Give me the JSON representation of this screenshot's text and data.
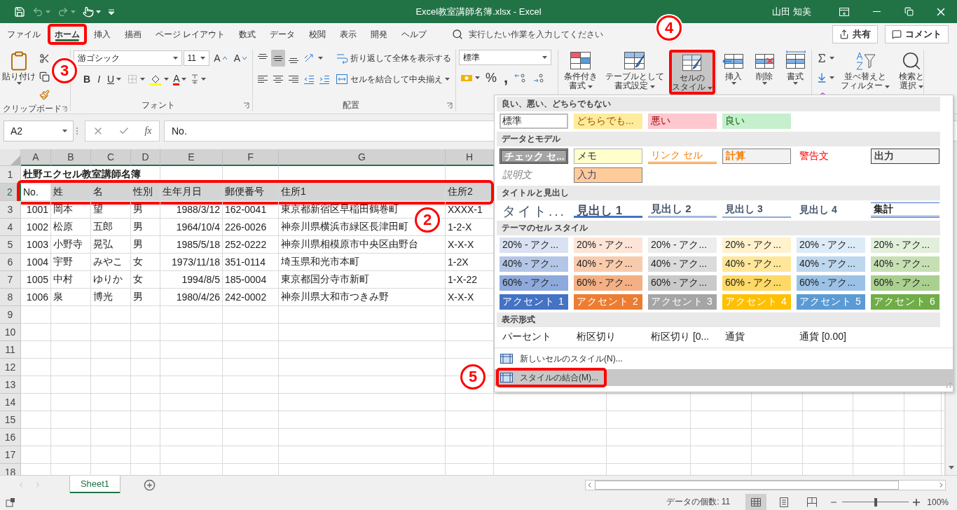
{
  "title_bar": {
    "title": "Excel教室講師名簿.xlsx  -  Excel",
    "user": "山田 知美",
    "quick_access": [
      {
        "kind": "save",
        "disabled": false
      },
      {
        "kind": "undo",
        "disabled": true
      },
      {
        "kind": "redo",
        "disabled": true
      },
      {
        "kind": "touch",
        "disabled": false
      }
    ]
  },
  "menu_tabs": [
    {
      "label": "ファイル",
      "selected": false,
      "highlighted": false
    },
    {
      "label": "ホーム",
      "selected": true,
      "highlighted": true
    },
    {
      "label": "挿入",
      "selected": false,
      "highlighted": false
    },
    {
      "label": "描画",
      "selected": false,
      "highlighted": false
    },
    {
      "label": "ページ レイアウト",
      "selected": false,
      "highlighted": false
    },
    {
      "label": "数式",
      "selected": false,
      "highlighted": false
    },
    {
      "label": "データ",
      "selected": false,
      "highlighted": false
    },
    {
      "label": "校閲",
      "selected": false,
      "highlighted": false
    },
    {
      "label": "表示",
      "selected": false,
      "highlighted": false
    },
    {
      "label": "開発",
      "selected": false,
      "highlighted": false
    },
    {
      "label": "ヘルプ",
      "selected": false,
      "highlighted": false
    }
  ],
  "search": {
    "placeholder": "実行したい作業を入力してください"
  },
  "share_button": "共有",
  "comment_button": "コメント",
  "ribbon": {
    "clipboard": {
      "paste": "貼り付け",
      "label": "クリップボード"
    },
    "font": {
      "name": "游ゴシック",
      "size": "11",
      "size_buttons": [
        "A",
        "A"
      ],
      "styles": [
        "B",
        "I",
        "U"
      ],
      "color_button": "A",
      "label": "フォント"
    },
    "alignment": {
      "vertical_align": [
        {
          "selected": false
        },
        {
          "selected": true
        },
        {
          "selected": false
        }
      ],
      "wrap": "折り返して全体を表示する",
      "merge": "セルを結合して中央揃え",
      "label": "配置"
    },
    "number": {
      "format": "標準",
      "percent": "%",
      "comma": ","
    },
    "styles": [
      {
        "lines": [
          "条件付き",
          "書式"
        ],
        "selected": false,
        "highlighted": false
      },
      {
        "lines": [
          "テーブルとして",
          "書式設定"
        ],
        "selected": false,
        "highlighted": false
      },
      {
        "lines": [
          "セルの",
          "スタイル"
        ],
        "selected": true,
        "highlighted": true
      }
    ],
    "cells": [
      {
        "lines": [
          "挿入"
        ]
      },
      {
        "lines": [
          "削除"
        ]
      },
      {
        "lines": [
          "書式"
        ]
      }
    ],
    "editing": [
      {
        "lines": [
          "並べ替えと",
          "フィルター"
        ]
      },
      {
        "lines": [
          "検索と",
          "選択"
        ]
      }
    ]
  },
  "formula_bar": {
    "name_box": "A2",
    "function_label": "fx",
    "formula": "No."
  },
  "sheet": {
    "columns": [
      {
        "label": "A",
        "numeric": true
      },
      {
        "label": "B",
        "numeric": false
      },
      {
        "label": "C",
        "numeric": false
      },
      {
        "label": "D",
        "numeric": false
      },
      {
        "label": "E",
        "numeric": true
      },
      {
        "label": "F",
        "numeric": false
      },
      {
        "label": "G",
        "numeric": false
      },
      {
        "label": "H",
        "numeric": false
      }
    ],
    "rows": [
      {
        "number": "1",
        "kind": "title",
        "selected": false,
        "highlighted": false,
        "cells": [
          "杜野エクセル教室講師名簿"
        ]
      },
      {
        "number": "2",
        "kind": "header",
        "selected": true,
        "highlighted": true,
        "cells": [
          "No.",
          "姓",
          "名",
          "性別",
          "生年月日",
          "郵便番号",
          "住所1",
          "住所2"
        ]
      },
      {
        "number": "3",
        "kind": "data",
        "selected": false,
        "highlighted": false,
        "cells": [
          "1001",
          "岡本",
          "望",
          "男",
          "1988/3/12",
          "162-0041",
          "東京都新宿区早稲田鶴巻町",
          "XXXX-1"
        ]
      },
      {
        "number": "4",
        "kind": "data",
        "selected": false,
        "highlighted": false,
        "cells": [
          "1002",
          "松原",
          "五郎",
          "男",
          "1964/10/4",
          "226-0026",
          "神奈川県横浜市緑区長津田町",
          "1-2-X"
        ]
      },
      {
        "number": "5",
        "kind": "data",
        "selected": false,
        "highlighted": false,
        "cells": [
          "1003",
          "小野寺",
          "晃弘",
          "男",
          "1985/5/18",
          "252-0222",
          "神奈川県相模原市中央区由野台",
          "X-X-X"
        ]
      },
      {
        "number": "6",
        "kind": "data",
        "selected": false,
        "highlighted": false,
        "cells": [
          "1004",
          "宇野",
          "みやこ",
          "女",
          "1973/11/18",
          "351-0114",
          "埼玉県和光市本町",
          "1-2X"
        ]
      },
      {
        "number": "7",
        "kind": "data",
        "selected": false,
        "highlighted": false,
        "cells": [
          "1005",
          "中村",
          "ゆりか",
          "女",
          "1994/8/5",
          "185-0004",
          "東京都国分寺市新町",
          "1-X-22"
        ]
      },
      {
        "number": "8",
        "kind": "data",
        "selected": false,
        "highlighted": false,
        "cells": [
          "1006",
          "泉",
          "博光",
          "男",
          "1980/4/26",
          "242-0002",
          "神奈川県大和市つきみ野",
          "X-X-X"
        ]
      },
      {
        "number": "9",
        "kind": "empty",
        "selected": false,
        "highlighted": false,
        "cells": []
      },
      {
        "number": "10",
        "kind": "empty",
        "selected": false,
        "highlighted": false,
        "cells": []
      },
      {
        "number": "11",
        "kind": "empty",
        "selected": false,
        "highlighted": false,
        "cells": []
      },
      {
        "number": "12",
        "kind": "empty",
        "selected": false,
        "highlighted": false,
        "cells": []
      },
      {
        "number": "13",
        "kind": "empty",
        "selected": false,
        "highlighted": false,
        "cells": []
      },
      {
        "number": "14",
        "kind": "empty",
        "selected": false,
        "highlighted": false,
        "cells": []
      },
      {
        "number": "15",
        "kind": "empty",
        "selected": false,
        "highlighted": false,
        "cells": []
      },
      {
        "number": "16",
        "kind": "empty",
        "selected": false,
        "highlighted": false,
        "cells": []
      },
      {
        "number": "17",
        "kind": "empty",
        "selected": false,
        "highlighted": false,
        "cells": []
      },
      {
        "number": "18",
        "kind": "empty",
        "selected": false,
        "highlighted": false,
        "cells": []
      }
    ]
  },
  "sheet_tabs": [
    {
      "label": "Sheet1",
      "selected": true
    }
  ],
  "status_bar": {
    "summary": "データの個数: 11",
    "zoom": "100%",
    "zoom_slider": {
      "level": 0.5
    }
  },
  "style_gallery": {
    "sections": [
      {
        "title": "良い、悪い、どちらでもない",
        "items": [
          {
            "label": "標準",
            "kind": "normal",
            "selected": true
          },
          {
            "label": "どちらでも...",
            "kind": "neutral",
            "selected": false
          },
          {
            "label": "悪い",
            "kind": "bad",
            "selected": false
          },
          {
            "label": "良い",
            "kind": "good",
            "selected": false
          }
        ]
      },
      {
        "title": "データとモデル",
        "items": [
          {
            "label": "チェック セ...",
            "kind": "check",
            "selected": false
          },
          {
            "label": "メモ",
            "kind": "memo",
            "selected": false
          },
          {
            "label": "リンク セル",
            "kind": "link",
            "selected": false
          },
          {
            "label": "計算",
            "kind": "calc",
            "selected": false
          },
          {
            "label": "警告文",
            "kind": "warning",
            "selected": false
          },
          {
            "label": "出力",
            "kind": "output",
            "selected": false
          },
          {
            "label": "説明文",
            "kind": "explanatory",
            "selected": false
          },
          {
            "label": "入力",
            "kind": "input",
            "selected": false
          }
        ]
      },
      {
        "title": "タイトルと見出し",
        "items": [
          {
            "label": "タイト...",
            "kind": "title",
            "selected": false
          },
          {
            "label": "見出し 1",
            "kind": "heading1",
            "selected": false
          },
          {
            "label": "見出し 2",
            "kind": "heading2",
            "selected": false
          },
          {
            "label": "見出し 3",
            "kind": "heading3",
            "selected": false
          },
          {
            "label": "見出し 4",
            "kind": "heading4",
            "selected": false
          },
          {
            "label": "集計",
            "kind": "total",
            "selected": false
          }
        ]
      },
      {
        "title": "テーマのセル スタイル",
        "items": [
          {
            "label": "20% - アク...",
            "kind": "tint",
            "color": "#d9e1f2",
            "selected": false
          },
          {
            "label": "20% - アク...",
            "kind": "tint",
            "color": "#fce4d6",
            "selected": false
          },
          {
            "label": "20% - アク...",
            "kind": "tint",
            "color": "#ededed",
            "selected": false
          },
          {
            "label": "20% - アク...",
            "kind": "tint",
            "color": "#fff2cc",
            "selected": false
          },
          {
            "label": "20% - アク...",
            "kind": "tint",
            "color": "#ddebf7",
            "selected": false
          },
          {
            "label": "20% - アク...",
            "kind": "tint",
            "color": "#e2efda",
            "selected": false
          },
          {
            "label": "40% - アク...",
            "kind": "tint",
            "color": "#b4c6e7",
            "selected": false
          },
          {
            "label": "40% - アク...",
            "kind": "tint",
            "color": "#f8cbad",
            "selected": false
          },
          {
            "label": "40% - アク...",
            "kind": "tint",
            "color": "#dbdbdb",
            "selected": false
          },
          {
            "label": "40% - アク...",
            "kind": "tint",
            "color": "#ffe699",
            "selected": false
          },
          {
            "label": "40% - アク...",
            "kind": "tint",
            "color": "#bdd7ee",
            "selected": false
          },
          {
            "label": "40% - アク...",
            "kind": "tint",
            "color": "#c6e0b4",
            "selected": false
          },
          {
            "label": "60% - アク...",
            "kind": "tint",
            "color": "#8ea9db",
            "selected": false
          },
          {
            "label": "60% - アク...",
            "kind": "tint",
            "color": "#f4b084",
            "selected": false
          },
          {
            "label": "60% - アク...",
            "kind": "tint",
            "color": "#c9c9c9",
            "selected": false
          },
          {
            "label": "60% - アク...",
            "kind": "tint",
            "color": "#ffd966",
            "selected": false
          },
          {
            "label": "60% - アク...",
            "kind": "tint",
            "color": "#9bc2e6",
            "selected": false
          },
          {
            "label": "60% - アク...",
            "kind": "tint",
            "color": "#a9d08e",
            "selected": false
          },
          {
            "label": "アクセント 1",
            "kind": "accent",
            "color": "#4472c4",
            "selected": false
          },
          {
            "label": "アクセント 2",
            "kind": "accent",
            "color": "#ed7d31",
            "selected": false
          },
          {
            "label": "アクセント 3",
            "kind": "accent",
            "color": "#a5a5a5",
            "selected": false
          },
          {
            "label": "アクセント 4",
            "kind": "accent",
            "color": "#ffc000",
            "selected": false
          },
          {
            "label": "アクセント 5",
            "kind": "accent",
            "color": "#5b9bd5",
            "selected": false
          },
          {
            "label": "アクセント 6",
            "kind": "accent",
            "color": "#70ad47",
            "selected": false
          }
        ]
      },
      {
        "title": "表示形式",
        "items": [
          {
            "label": "パーセント",
            "kind": "plain",
            "selected": false
          },
          {
            "label": "桁区切り",
            "kind": "plain",
            "selected": false
          },
          {
            "label": "桁区切り [0...",
            "kind": "plain",
            "selected": false
          },
          {
            "label": "通貨",
            "kind": "plain",
            "selected": false
          },
          {
            "label": "通貨 [0.00]",
            "kind": "plain",
            "selected": false
          }
        ]
      }
    ],
    "commands": [
      {
        "label": "新しいセルのスタイル(N)...",
        "selected": false,
        "highlighted": false
      },
      {
        "label": "スタイルの結合(M)...",
        "selected": true,
        "highlighted": true
      }
    ]
  },
  "callouts": [
    "4",
    "3",
    "2",
    "5"
  ]
}
